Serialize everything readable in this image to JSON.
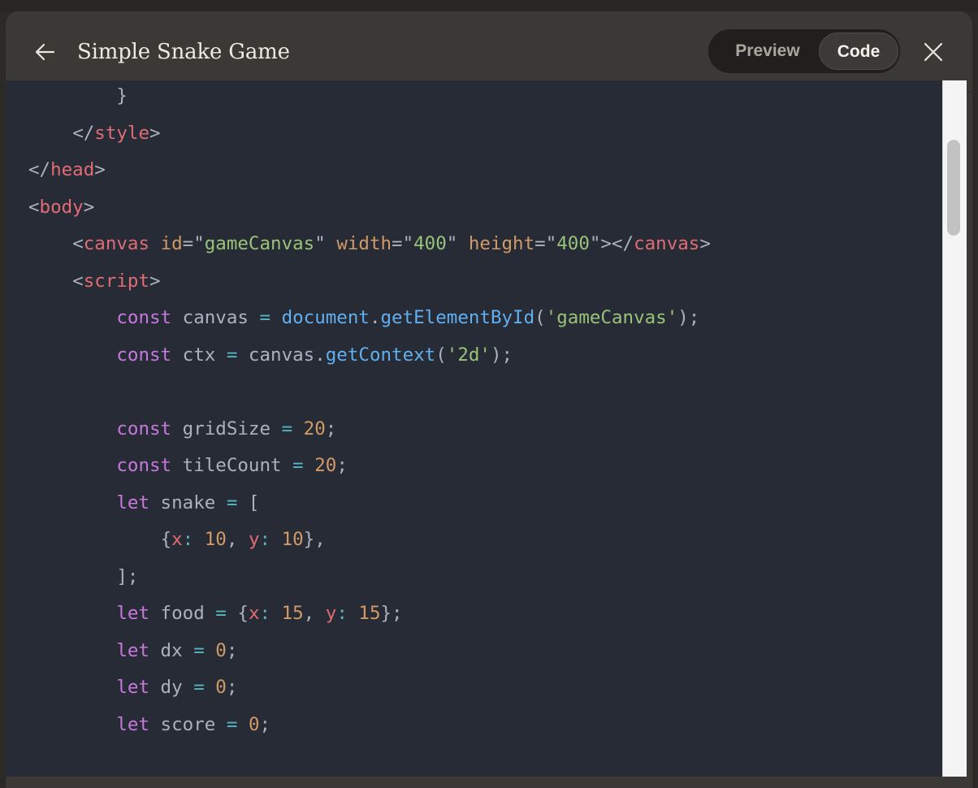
{
  "header": {
    "back_icon": "arrow-left-icon",
    "title": "Simple Snake Game",
    "toggle": {
      "preview_label": "Preview",
      "code_label": "Code",
      "selected": "Code"
    },
    "close_icon": "close-icon"
  },
  "colors": {
    "panel_bg": "#3a3936",
    "code_bg": "#272b35",
    "tag": "#e06c75",
    "attr": "#d19a66",
    "string": "#98c379",
    "keyword": "#c678dd",
    "function": "#61afef",
    "number": "#d19a66",
    "operator": "#56b6c2",
    "text": "#abb2bf"
  },
  "code_lines": [
    {
      "indent": "        ",
      "tokens": [
        {
          "t": "punc",
          "v": "}"
        }
      ]
    },
    {
      "indent": "    ",
      "tokens": [
        {
          "t": "punc",
          "v": "</"
        },
        {
          "t": "tag",
          "v": "style"
        },
        {
          "t": "punc",
          "v": ">"
        }
      ]
    },
    {
      "indent": "",
      "tokens": [
        {
          "t": "punc",
          "v": "</"
        },
        {
          "t": "tag",
          "v": "head"
        },
        {
          "t": "punc",
          "v": ">"
        }
      ]
    },
    {
      "indent": "",
      "tokens": [
        {
          "t": "punc",
          "v": "<"
        },
        {
          "t": "tag",
          "v": "body"
        },
        {
          "t": "punc",
          "v": ">"
        }
      ]
    },
    {
      "indent": "    ",
      "tokens": [
        {
          "t": "punc",
          "v": "<"
        },
        {
          "t": "tag",
          "v": "canvas"
        },
        {
          "t": "plain",
          "v": " "
        },
        {
          "t": "attr",
          "v": "id"
        },
        {
          "t": "punc",
          "v": "=\""
        },
        {
          "t": "str",
          "v": "gameCanvas"
        },
        {
          "t": "punc",
          "v": "\""
        },
        {
          "t": "plain",
          "v": " "
        },
        {
          "t": "attr",
          "v": "width"
        },
        {
          "t": "punc",
          "v": "=\""
        },
        {
          "t": "str",
          "v": "400"
        },
        {
          "t": "punc",
          "v": "\""
        },
        {
          "t": "plain",
          "v": " "
        },
        {
          "t": "attr",
          "v": "height"
        },
        {
          "t": "punc",
          "v": "=\""
        },
        {
          "t": "str",
          "v": "400"
        },
        {
          "t": "punc",
          "v": "\"></"
        },
        {
          "t": "tag",
          "v": "canvas"
        },
        {
          "t": "punc",
          "v": ">"
        }
      ]
    },
    {
      "indent": "    ",
      "tokens": [
        {
          "t": "punc",
          "v": "<"
        },
        {
          "t": "tag",
          "v": "script"
        },
        {
          "t": "punc",
          "v": ">"
        }
      ]
    },
    {
      "indent": "        ",
      "tokens": [
        {
          "t": "kw",
          "v": "const"
        },
        {
          "t": "plain",
          "v": " canvas "
        },
        {
          "t": "op",
          "v": "="
        },
        {
          "t": "plain",
          "v": " "
        },
        {
          "t": "fn",
          "v": "document"
        },
        {
          "t": "punc",
          "v": "."
        },
        {
          "t": "fn",
          "v": "getElementById"
        },
        {
          "t": "punc",
          "v": "("
        },
        {
          "t": "str",
          "v": "'gameCanvas'"
        },
        {
          "t": "punc",
          "v": ");"
        }
      ]
    },
    {
      "indent": "        ",
      "tokens": [
        {
          "t": "kw",
          "v": "const"
        },
        {
          "t": "plain",
          "v": " ctx "
        },
        {
          "t": "op",
          "v": "="
        },
        {
          "t": "plain",
          "v": " canvas."
        },
        {
          "t": "fn",
          "v": "getContext"
        },
        {
          "t": "punc",
          "v": "("
        },
        {
          "t": "str",
          "v": "'2d'"
        },
        {
          "t": "punc",
          "v": ");"
        }
      ]
    },
    {
      "indent": "",
      "tokens": []
    },
    {
      "indent": "        ",
      "tokens": [
        {
          "t": "kw",
          "v": "const"
        },
        {
          "t": "plain",
          "v": " gridSize "
        },
        {
          "t": "op",
          "v": "="
        },
        {
          "t": "plain",
          "v": " "
        },
        {
          "t": "num",
          "v": "20"
        },
        {
          "t": "punc",
          "v": ";"
        }
      ]
    },
    {
      "indent": "        ",
      "tokens": [
        {
          "t": "kw",
          "v": "const"
        },
        {
          "t": "plain",
          "v": " tileCount "
        },
        {
          "t": "op",
          "v": "="
        },
        {
          "t": "plain",
          "v": " "
        },
        {
          "t": "num",
          "v": "20"
        },
        {
          "t": "punc",
          "v": ";"
        }
      ]
    },
    {
      "indent": "        ",
      "tokens": [
        {
          "t": "kw",
          "v": "let"
        },
        {
          "t": "plain",
          "v": " snake "
        },
        {
          "t": "op",
          "v": "="
        },
        {
          "t": "plain",
          "v": " ["
        }
      ]
    },
    {
      "indent": "            ",
      "tokens": [
        {
          "t": "punc",
          "v": "{"
        },
        {
          "t": "prop",
          "v": "x"
        },
        {
          "t": "op",
          "v": ":"
        },
        {
          "t": "plain",
          "v": " "
        },
        {
          "t": "num",
          "v": "10"
        },
        {
          "t": "punc",
          "v": ", "
        },
        {
          "t": "prop",
          "v": "y"
        },
        {
          "t": "op",
          "v": ":"
        },
        {
          "t": "plain",
          "v": " "
        },
        {
          "t": "num",
          "v": "10"
        },
        {
          "t": "punc",
          "v": "},"
        }
      ]
    },
    {
      "indent": "        ",
      "tokens": [
        {
          "t": "punc",
          "v": "];"
        }
      ]
    },
    {
      "indent": "        ",
      "tokens": [
        {
          "t": "kw",
          "v": "let"
        },
        {
          "t": "plain",
          "v": " food "
        },
        {
          "t": "op",
          "v": "="
        },
        {
          "t": "plain",
          "v": " {"
        },
        {
          "t": "prop",
          "v": "x"
        },
        {
          "t": "op",
          "v": ":"
        },
        {
          "t": "plain",
          "v": " "
        },
        {
          "t": "num",
          "v": "15"
        },
        {
          "t": "punc",
          "v": ", "
        },
        {
          "t": "prop",
          "v": "y"
        },
        {
          "t": "op",
          "v": ":"
        },
        {
          "t": "plain",
          "v": " "
        },
        {
          "t": "num",
          "v": "15"
        },
        {
          "t": "punc",
          "v": "};"
        }
      ]
    },
    {
      "indent": "        ",
      "tokens": [
        {
          "t": "kw",
          "v": "let"
        },
        {
          "t": "plain",
          "v": " dx "
        },
        {
          "t": "op",
          "v": "="
        },
        {
          "t": "plain",
          "v": " "
        },
        {
          "t": "num",
          "v": "0"
        },
        {
          "t": "punc",
          "v": ";"
        }
      ]
    },
    {
      "indent": "        ",
      "tokens": [
        {
          "t": "kw",
          "v": "let"
        },
        {
          "t": "plain",
          "v": " dy "
        },
        {
          "t": "op",
          "v": "="
        },
        {
          "t": "plain",
          "v": " "
        },
        {
          "t": "num",
          "v": "0"
        },
        {
          "t": "punc",
          "v": ";"
        }
      ]
    },
    {
      "indent": "        ",
      "tokens": [
        {
          "t": "kw",
          "v": "let"
        },
        {
          "t": "plain",
          "v": " score "
        },
        {
          "t": "op",
          "v": "="
        },
        {
          "t": "plain",
          "v": " "
        },
        {
          "t": "num",
          "v": "0"
        },
        {
          "t": "punc",
          "v": ";"
        }
      ]
    }
  ]
}
